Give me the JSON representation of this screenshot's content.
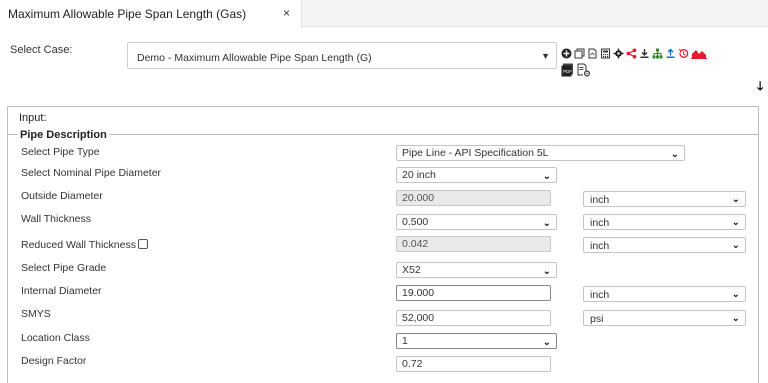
{
  "tab": {
    "title": "Maximum Allowable Pipe Span Length (Gas)",
    "close": "×"
  },
  "case": {
    "label": "Select Case:",
    "value": "Demo - Maximum Allowable Pipe Span Length (G)"
  },
  "toolbar": {
    "icons": [
      "add-circle-icon",
      "copy-icon",
      "pdf-icon",
      "calculator-icon",
      "settings-icon",
      "share-icon",
      "download-icon",
      "hierarchy-icon",
      "upload-icon",
      "history-icon",
      "chart-icon",
      "pdf-report-icon",
      "document-settings-icon",
      "scroll-down-arrow-icon"
    ],
    "colors": {
      "share": "#e8192c",
      "download": "#333333",
      "hierarchy": "#2e8b2e",
      "upload": "#1a6fc4",
      "history": "#e8192c",
      "chart": "#e8192c"
    }
  },
  "input": {
    "legend": "Input:",
    "section": "Pipe Description",
    "rows": {
      "pipe_type": {
        "label": "Select Pipe Type",
        "value": "Pipe Line - API Specification 5L"
      },
      "nominal_diameter": {
        "label": "Select Nominal Pipe Diameter",
        "value": "20 inch"
      },
      "outside_diameter": {
        "label": "Outside Diameter",
        "value": "20.000",
        "unit": "inch"
      },
      "wall_thickness": {
        "label": "Wall Thickness",
        "value": "0.500",
        "unit": "inch"
      },
      "reduced_wall_thickness": {
        "label": "Reduced Wall Thickness",
        "value": "0.042",
        "unit": "inch"
      },
      "pipe_grade": {
        "label": "Select Pipe Grade",
        "value": "X52"
      },
      "internal_diameter": {
        "label": "Internal Diameter",
        "value": "19.000",
        "unit": "inch"
      },
      "smys": {
        "label": "SMYS",
        "value": "52,000",
        "unit": "psi"
      },
      "location_class": {
        "label": "Location Class",
        "value": "1"
      },
      "design_factor": {
        "label": "Design Factor",
        "value": "0.72"
      }
    }
  }
}
